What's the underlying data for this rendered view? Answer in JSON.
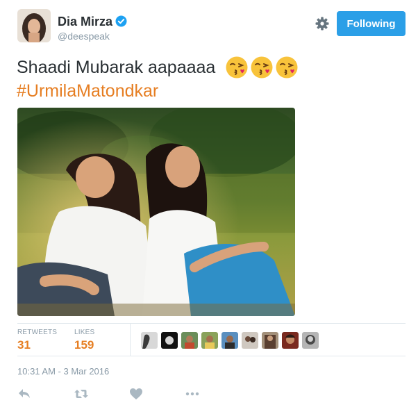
{
  "user": {
    "name": "Dia Mirza",
    "handle": "@deespeak",
    "verified": true
  },
  "follow_button": {
    "label": "Following"
  },
  "tweet": {
    "text": "Shaadi Mubarak aapaaaa",
    "emoji": [
      "face-blowing-a-kiss",
      "face-blowing-a-kiss",
      "face-blowing-a-kiss"
    ],
    "hashtag": "#UrmilaMatondkar"
  },
  "stats": {
    "retweets_label": "RETWEETS",
    "retweets": "31",
    "likes_label": "LIKES",
    "likes": "159",
    "liker_avatar_count": 9
  },
  "timestamp": "10:31 AM - 3 Mar 2016",
  "actions": [
    "reply-icon",
    "retweet-icon",
    "like-icon",
    "more-icon"
  ],
  "colors": {
    "accent_link": "#e67e22",
    "follow_button_bg": "#2b9fe7",
    "verified_badge": "#1da1f2",
    "muted_text": "#8899a6",
    "body_text": "#292f33"
  }
}
